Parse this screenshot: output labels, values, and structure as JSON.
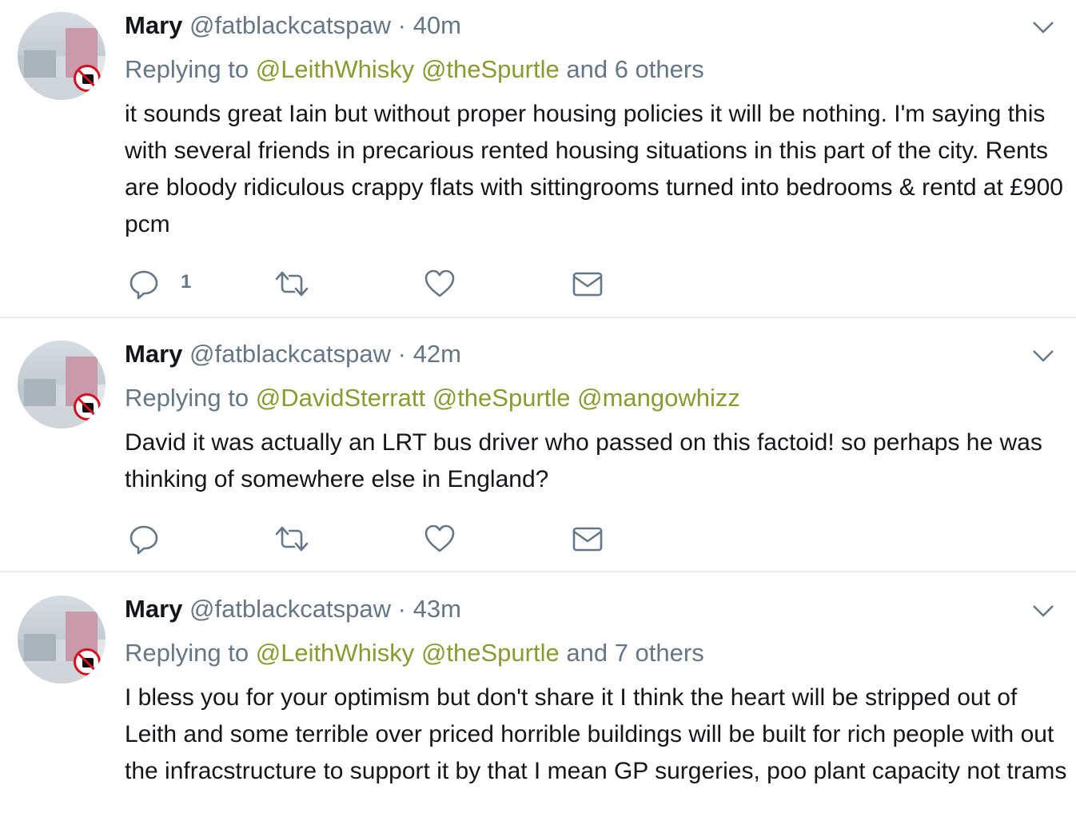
{
  "tweets": [
    {
      "name": "Mary",
      "handle": "@fatblackcatspaw",
      "time": "40m",
      "replying_prefix": "Replying to",
      "mentions": [
        "@LeithWhisky",
        "@theSpurtle"
      ],
      "others": "and 6 others",
      "text": "it sounds great Iain but without proper housing policies it will be nothing. I'm saying this with several friends in precarious rented housing situations in this part of the city. Rents are bloody ridiculous crappy flats with sittingrooms turned into bedrooms & rentd at £900 pcm",
      "reply_count": "1"
    },
    {
      "name": "Mary",
      "handle": "@fatblackcatspaw",
      "time": "42m",
      "replying_prefix": "Replying to",
      "mentions": [
        "@DavidSterratt",
        "@theSpurtle",
        "@mangowhizz"
      ],
      "others": "",
      "text": "David it was actually an LRT bus driver who passed on this factoid! so perhaps he was thinking of somewhere else in England?",
      "reply_count": ""
    },
    {
      "name": "Mary",
      "handle": "@fatblackcatspaw",
      "time": "43m",
      "replying_prefix": "Replying to",
      "mentions": [
        "@LeithWhisky",
        "@theSpurtle"
      ],
      "others": "and 7 others",
      "text": "I bless you for your optimism but don't share it I think the heart will be stripped out of Leith and some terrible over priced horrible buildings will be built for rich people with out the infracstructure to support it by that I mean GP surgeries, poo plant capacity not trams",
      "reply_count": ""
    }
  ],
  "separator": "·",
  "colors": {
    "mention": "#8a9a2f",
    "secondary": "#657786",
    "divider": "#e6ecf0"
  },
  "icons": [
    "reply-icon",
    "retweet-icon",
    "like-icon",
    "message-icon",
    "chevron-down-icon"
  ]
}
